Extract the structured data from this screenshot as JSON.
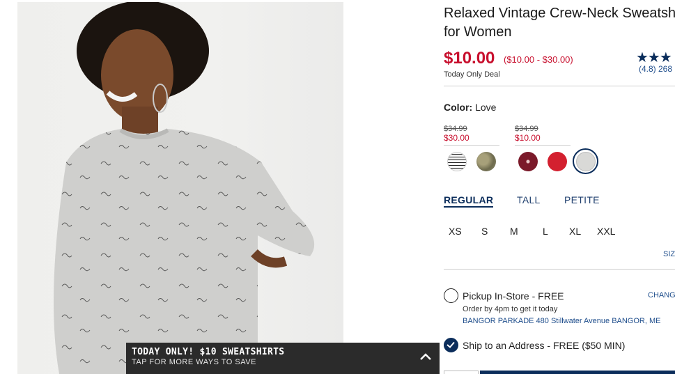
{
  "product": {
    "title": "Relaxed Vintage Crew-Neck Sweatshirt for Women",
    "price": "$10.00",
    "price_range": "($10.00 - $30.00)",
    "deal_label": "Today Only Deal",
    "stars": "★★★",
    "rating_text": "(4.8) 268"
  },
  "color": {
    "label": "Color:",
    "selected": "Love",
    "groups": [
      {
        "old_price": "$34.99",
        "new_price": "$30.00"
      },
      {
        "old_price": "$34.99",
        "new_price": "$10.00"
      }
    ],
    "swatches": [
      {
        "name": "white-stripe",
        "color": "#f2f2f2"
      },
      {
        "name": "camo",
        "color": "#8a8a6a"
      },
      {
        "name": "burgundy-dot",
        "color": "#7b1a2a"
      },
      {
        "name": "red-love",
        "color": "#d3202f"
      },
      {
        "name": "heather-love",
        "color": "#d9d9d7"
      }
    ]
  },
  "fits": [
    "REGULAR",
    "TALL",
    "PETITE"
  ],
  "sizes": [
    "XS",
    "S",
    "M",
    "L",
    "XL",
    "XXL"
  ],
  "size_chart_label": "SIZ",
  "fulfillment": {
    "pickup_label": "Pickup In-Store - FREE",
    "change_label": "CHANG",
    "pickup_note": "Order by 4pm to get it today",
    "store_address": "BANGOR PARKADE 480 Stillwater Avenue  BANGOR, ME",
    "ship_label": "Ship to an Address - FREE ($50 MIN)"
  },
  "promo": {
    "title": "TODAY ONLY! $10 SWEATSHIRTS",
    "subtitle": "TAP FOR MORE WAYS TO SAVE"
  },
  "colors": {
    "sale_red": "#c8102e",
    "navy": "#0b2d5b",
    "banner": "#2b2b2b"
  }
}
